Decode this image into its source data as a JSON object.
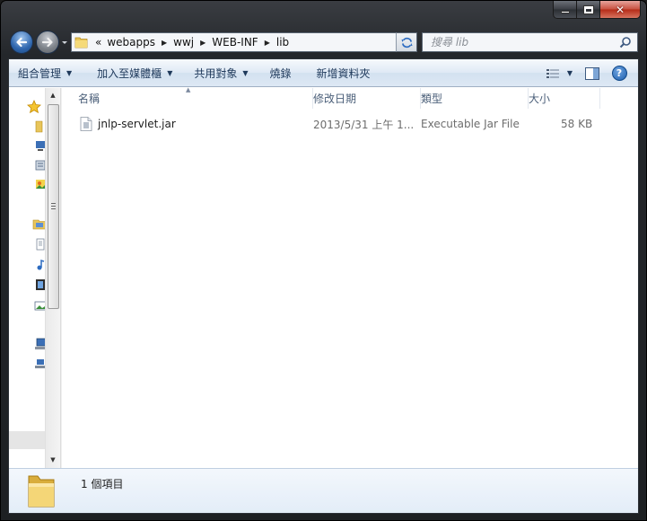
{
  "window": {
    "caption_close": "✕"
  },
  "address_bar": {
    "overflow": "«",
    "crumbs": [
      "webapps",
      "wwj",
      "WEB-INF",
      "lib"
    ]
  },
  "search": {
    "placeholder": "搜尋 lib"
  },
  "toolbar": {
    "organize": "組合管理",
    "include_in_library": "加入至媒體櫃",
    "share_with": "共用對象",
    "burn": "燒錄",
    "new_folder": "新增資料夾",
    "help_label": "?"
  },
  "columns": {
    "name": "名稱",
    "date_modified": "修改日期",
    "type": "類型",
    "size": "大小"
  },
  "files": [
    {
      "name": "jnlp-servlet.jar",
      "date_modified": "2013/5/31 上午 1...",
      "type": "Executable Jar File",
      "size": "58 KB"
    }
  ],
  "details": {
    "item_count": "1 個項目"
  },
  "colors": {
    "toolbar_text": "#1e395b",
    "column_header_text": "#4c607a",
    "window_frame": "#24272b",
    "close_button": "#c8503f"
  },
  "icons": [
    "back-arrow-icon",
    "forward-arrow-icon",
    "folder-icon",
    "refresh-icon",
    "search-icon",
    "view-icon",
    "preview-pane-icon",
    "help-icon",
    "favorites-star-icon",
    "jar-file-icon"
  ]
}
